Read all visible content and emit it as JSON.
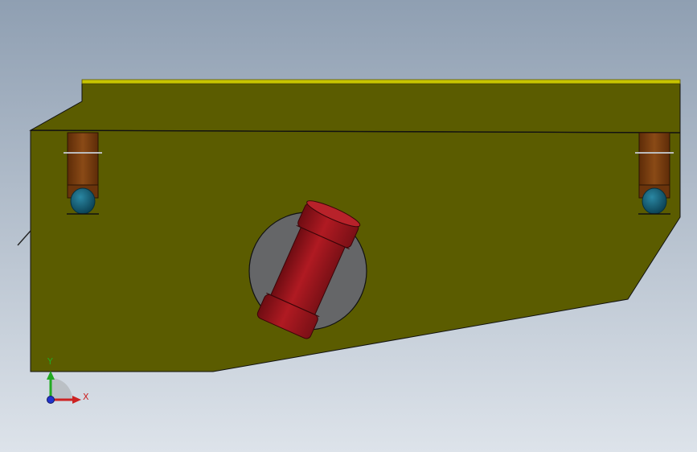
{
  "viewport": {
    "background_top": "#8f9fb2",
    "background_bottom": "#dde3ea"
  },
  "model": {
    "body_color": "#5b5c00",
    "top_rail_color": "#c8c400",
    "bracket_color": "#7a3c0e",
    "foot_color": "#0f5c74",
    "opening_color": "#656668",
    "motor_color": "#a0141c",
    "edge_color": "#111111"
  },
  "triad": {
    "y_label": "Y",
    "x_label": "X",
    "y_color": "#22aa22",
    "x_color": "#cc2222",
    "z_color": "#2233cc"
  }
}
